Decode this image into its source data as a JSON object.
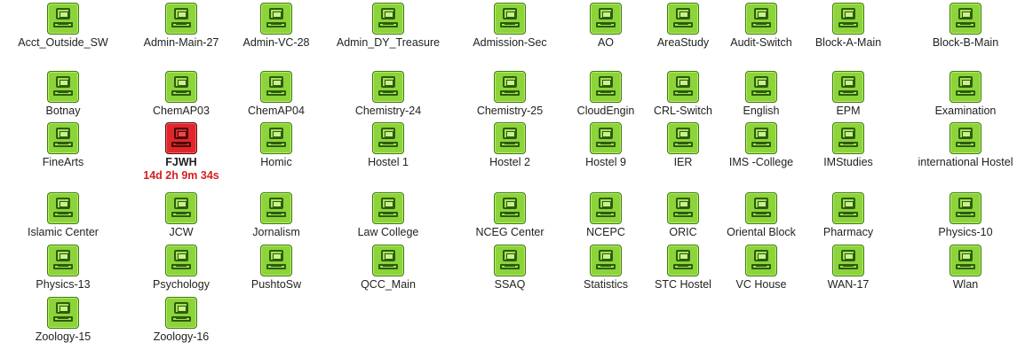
{
  "colors": {
    "up": "#8cd43a",
    "down": "#e0262a",
    "downtime_text": "#d42020"
  },
  "devices": [
    {
      "name": "Acct_Outside_SW",
      "status": "up",
      "icon": "computer-icon"
    },
    {
      "name": "Admin-Main-27",
      "status": "up",
      "icon": "computer-icon"
    },
    {
      "name": "Admin-VC-28",
      "status": "up",
      "icon": "computer-icon"
    },
    {
      "name": "Admin_DY_Treasure",
      "status": "up",
      "icon": "computer-icon"
    },
    {
      "name": "Admission-Sec",
      "status": "up",
      "icon": "computer-icon"
    },
    {
      "name": "AO",
      "status": "up",
      "icon": "computer-icon"
    },
    {
      "name": "AreaStudy",
      "status": "up",
      "icon": "computer-icon"
    },
    {
      "name": "Audit-Switch",
      "status": "up",
      "icon": "computer-icon"
    },
    {
      "name": "Block-A-Main",
      "status": "up",
      "icon": "computer-icon"
    },
    {
      "name": "Block-B-Main",
      "status": "up",
      "icon": "computer-icon"
    },
    {
      "name": "Botnay",
      "status": "up",
      "icon": "computer-icon"
    },
    {
      "name": "ChemAP03",
      "status": "up",
      "icon": "computer-icon"
    },
    {
      "name": "ChemAP04",
      "status": "up",
      "icon": "computer-icon"
    },
    {
      "name": "Chemistry-24",
      "status": "up",
      "icon": "computer-icon"
    },
    {
      "name": "Chemistry-25",
      "status": "up",
      "icon": "computer-icon"
    },
    {
      "name": "CloudEngin",
      "status": "up",
      "icon": "computer-icon"
    },
    {
      "name": "CRL-Switch",
      "status": "up",
      "icon": "computer-icon"
    },
    {
      "name": "English",
      "status": "up",
      "icon": "computer-icon"
    },
    {
      "name": "EPM",
      "status": "up",
      "icon": "computer-icon"
    },
    {
      "name": "Examination",
      "status": "up",
      "icon": "computer-icon"
    },
    {
      "name": "FineArts",
      "status": "up",
      "icon": "computer-icon"
    },
    {
      "name": "FJWH",
      "status": "down",
      "downtime": "14d 2h 9m 34s",
      "icon": "computer-icon"
    },
    {
      "name": "Homic",
      "status": "up",
      "icon": "computer-icon"
    },
    {
      "name": "Hostel 1",
      "status": "up",
      "icon": "computer-icon"
    },
    {
      "name": "Hostel 2",
      "status": "up",
      "icon": "computer-icon"
    },
    {
      "name": "Hostel 9",
      "status": "up",
      "icon": "computer-icon"
    },
    {
      "name": "IER",
      "status": "up",
      "icon": "computer-icon"
    },
    {
      "name": "IMS -College",
      "status": "up",
      "icon": "computer-icon"
    },
    {
      "name": "IMStudies",
      "status": "up",
      "icon": "computer-icon"
    },
    {
      "name": "international Hostel",
      "status": "up",
      "icon": "computer-icon"
    },
    {
      "name": "Islamic Center",
      "status": "up",
      "icon": "computer-icon"
    },
    {
      "name": "JCW",
      "status": "up",
      "icon": "computer-icon"
    },
    {
      "name": "Jornalism",
      "status": "up",
      "icon": "computer-icon"
    },
    {
      "name": "Law College",
      "status": "up",
      "icon": "computer-icon"
    },
    {
      "name": "NCEG Center",
      "status": "up",
      "icon": "computer-icon"
    },
    {
      "name": "NCEPC",
      "status": "up",
      "icon": "computer-icon"
    },
    {
      "name": "ORIC",
      "status": "up",
      "icon": "computer-icon"
    },
    {
      "name": "Oriental Block",
      "status": "up",
      "icon": "computer-icon"
    },
    {
      "name": "Pharmacy",
      "status": "up",
      "icon": "computer-icon"
    },
    {
      "name": "Physics-10",
      "status": "up",
      "icon": "computer-icon"
    },
    {
      "name": "Physics-13",
      "status": "up",
      "icon": "computer-icon"
    },
    {
      "name": "Psychology",
      "status": "up",
      "icon": "computer-icon"
    },
    {
      "name": "PushtoSw",
      "status": "up",
      "icon": "computer-icon"
    },
    {
      "name": "QCC_Main",
      "status": "up",
      "icon": "computer-icon"
    },
    {
      "name": "SSAQ",
      "status": "up",
      "icon": "computer-icon"
    },
    {
      "name": "Statistics",
      "status": "up",
      "icon": "computer-icon"
    },
    {
      "name": "STC Hostel",
      "status": "up",
      "icon": "computer-icon"
    },
    {
      "name": "VC House",
      "status": "up",
      "icon": "computer-icon"
    },
    {
      "name": "WAN-17",
      "status": "up",
      "icon": "computer-icon"
    },
    {
      "name": "Wlan",
      "status": "up",
      "icon": "computer-icon"
    },
    {
      "name": "Zoology-15",
      "status": "up",
      "icon": "computer-icon"
    },
    {
      "name": "Zoology-16",
      "status": "up",
      "icon": "computer-icon"
    }
  ]
}
